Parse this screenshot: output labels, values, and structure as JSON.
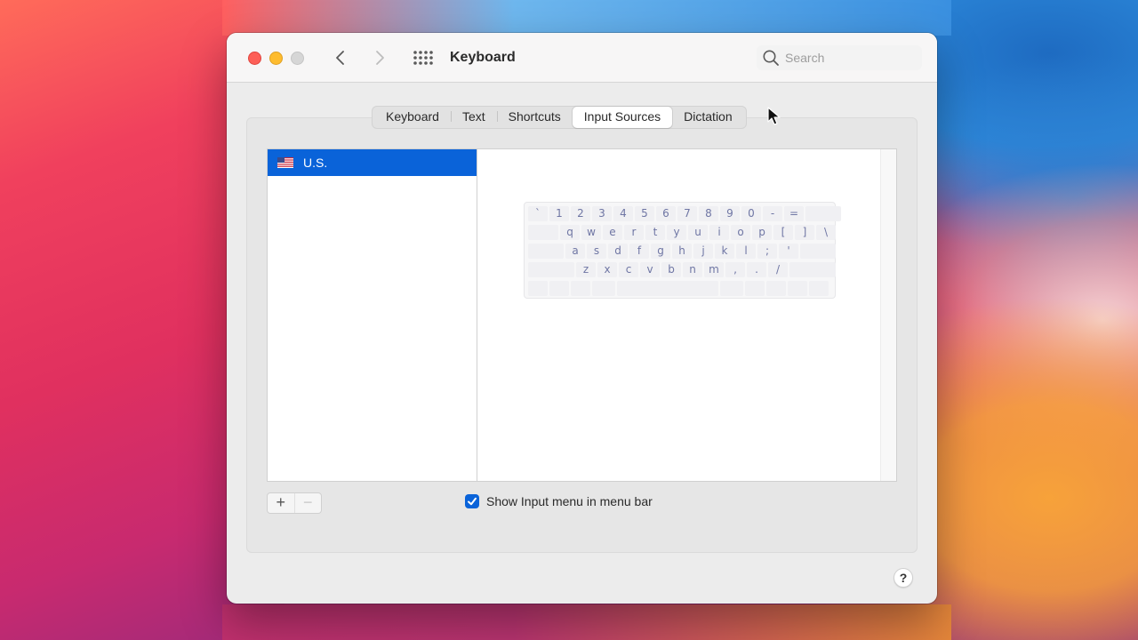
{
  "window": {
    "title": "Keyboard",
    "search": {
      "placeholder": "Search",
      "value": ""
    }
  },
  "tabs": [
    {
      "label": "Keyboard",
      "active": false
    },
    {
      "label": "Text",
      "active": false
    },
    {
      "label": "Shortcuts",
      "active": false
    },
    {
      "label": "Input Sources",
      "active": true
    },
    {
      "label": "Dictation",
      "active": false
    }
  ],
  "input_sources": {
    "items": [
      {
        "label": "U.S.",
        "flag": "us-flag-icon",
        "selected": true
      }
    ]
  },
  "keyboard_preview": {
    "row1": [
      "`",
      "1",
      "2",
      "3",
      "4",
      "5",
      "6",
      "7",
      "8",
      "9",
      "0",
      "-",
      "="
    ],
    "row2": [
      "q",
      "w",
      "e",
      "r",
      "t",
      "y",
      "u",
      "i",
      "o",
      "p",
      "[",
      "]",
      "\\"
    ],
    "row3": [
      "a",
      "s",
      "d",
      "f",
      "g",
      "h",
      "j",
      "k",
      "l",
      ";",
      "'"
    ],
    "row4": [
      "z",
      "x",
      "c",
      "v",
      "b",
      "n",
      "m",
      ",",
      ".",
      "/"
    ]
  },
  "controls": {
    "add_label": "+",
    "remove_label": "−",
    "show_input_menu_label": "Show Input menu in menu bar",
    "show_input_menu_checked": true,
    "help_label": "?"
  },
  "colors": {
    "accent": "#0a63d9",
    "close": "#fd5f57",
    "minimize": "#febc2e",
    "zoom_disabled": "#d6d6d6"
  }
}
